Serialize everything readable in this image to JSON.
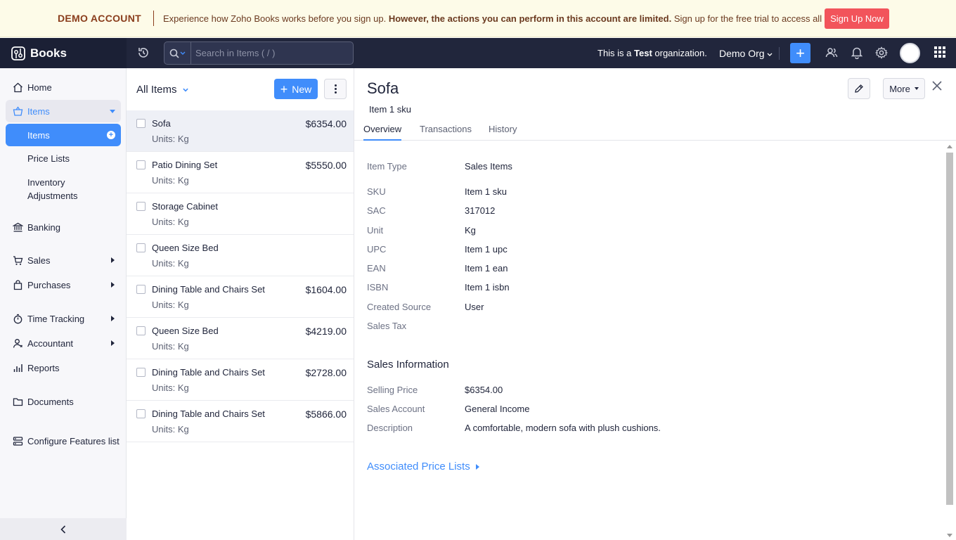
{
  "banner": {
    "demo_label": "DEMO ACCOUNT",
    "message_start": "Experience how Zoho Books works before you sign up. ",
    "message_bold": "However, the actions you can perform in this account are limited.",
    "message_end": " Sign up for the free trial to access all features.",
    "signup_label": "Sign Up Now"
  },
  "topnav": {
    "brand": "Books",
    "search_placeholder": "Search in Items ( / )",
    "org_note_start": "This is a ",
    "org_note_bold": "Test",
    "org_note_end": " organization.",
    "org_name": "Demo Org",
    "plus_label": "+"
  },
  "sidebar": {
    "home": "Home",
    "items_parent": "Items",
    "items_active": "Items",
    "price_lists": "Price Lists",
    "inventory_adjustments_1": "Inventory",
    "inventory_adjustments_2": "Adjustments",
    "banking": "Banking",
    "sales": "Sales",
    "purchases": "Purchases",
    "time_tracking": "Time Tracking",
    "accountant": "Accountant",
    "reports": "Reports",
    "documents": "Documents",
    "configure": "Configure Features list"
  },
  "list": {
    "view_label": "All Items",
    "new_label": "New",
    "rows": [
      {
        "name": "Sofa",
        "units": "Units: Kg",
        "price": "$6354.00"
      },
      {
        "name": "Patio Dining Set",
        "units": "Units: Kg",
        "price": "$5550.00"
      },
      {
        "name": "Storage Cabinet",
        "units": "Units: Kg",
        "price": ""
      },
      {
        "name": "Queen Size Bed",
        "units": "Units: Kg",
        "price": ""
      },
      {
        "name": "Dining Table and Chairs Set",
        "units": "Units: Kg",
        "price": "$1604.00"
      },
      {
        "name": "Queen Size Bed",
        "units": "Units: Kg",
        "price": "$4219.00"
      },
      {
        "name": "Dining Table and Chairs Set",
        "units": "Units: Kg",
        "price": "$2728.00"
      },
      {
        "name": "Dining Table and Chairs Set",
        "units": "Units: Kg",
        "price": "$5866.00"
      }
    ]
  },
  "detail": {
    "title": "Sofa",
    "sku": "Item 1 sku",
    "more_label": "More",
    "tabs": [
      "Overview",
      "Transactions",
      "History"
    ],
    "fields": [
      {
        "label": "Item Type",
        "value": "Sales Items"
      },
      {
        "label": "SKU",
        "value": "Item 1 sku"
      },
      {
        "label": "SAC",
        "value": "317012"
      },
      {
        "label": "Unit",
        "value": "Kg"
      },
      {
        "label": "UPC",
        "value": "Item 1 upc"
      },
      {
        "label": "EAN",
        "value": "Item 1 ean"
      },
      {
        "label": "ISBN",
        "value": "Item 1 isbn"
      },
      {
        "label": "Created Source",
        "value": "User"
      },
      {
        "label": "Sales Tax",
        "value": ""
      }
    ],
    "sales_section_title": "Sales Information",
    "sales_fields": [
      {
        "label": "Selling Price",
        "value": "$6354.00"
      },
      {
        "label": "Sales Account",
        "value": "General Income"
      },
      {
        "label": "Description",
        "value": "A comfortable, modern sofa with plush cushions."
      }
    ],
    "associated_label": "Associated Price Lists"
  },
  "colors": {
    "accent": "#408dfb",
    "nav_bg": "#21263c",
    "banner_bg": "#fdfbe8",
    "signup_bg": "#f2545b"
  }
}
